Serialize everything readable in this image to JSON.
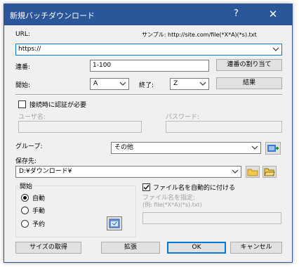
{
  "window": {
    "title": "新規バッチダウンロード",
    "help_label": "?",
    "close_label": "✕"
  },
  "url": {
    "label": "URL:",
    "sample": "サンプル: http://site.com/file(*X*A)(*s).txt",
    "value": "https://"
  },
  "sequence": {
    "label": "連番:",
    "value": "1-100",
    "assign_button": "連番の割り当て",
    "start_label": "開始:",
    "start_value": "A",
    "end_label": "終了:",
    "end_value": "Z",
    "result_button": "結果"
  },
  "auth": {
    "checkbox_label": "接続時に認証が必要",
    "checked": false,
    "user_label": "ユーザ名:",
    "password_label": "パスワード:"
  },
  "group": {
    "label": "グループ:",
    "value": "その他"
  },
  "save": {
    "label": "保存先:",
    "value": "D:¥ダウンロード¥"
  },
  "start_group": {
    "title": "開始",
    "options": [
      "自動",
      "手動",
      "予約"
    ],
    "selected": "自動"
  },
  "filename": {
    "auto_label": "ファイル名を自動的に付ける",
    "auto_checked": true,
    "specify_label": "ファイル名を指定:",
    "example": "(例: file(*X*A)(*s).txt)"
  },
  "buttons": {
    "get_size": "サイズの取得",
    "expand": "拡張",
    "ok": "OK",
    "cancel": "キャンセル"
  },
  "colors": {
    "titlebar": "#2b579a",
    "focus": "#0078d7",
    "dialog_bg": "#f0f0f0"
  }
}
